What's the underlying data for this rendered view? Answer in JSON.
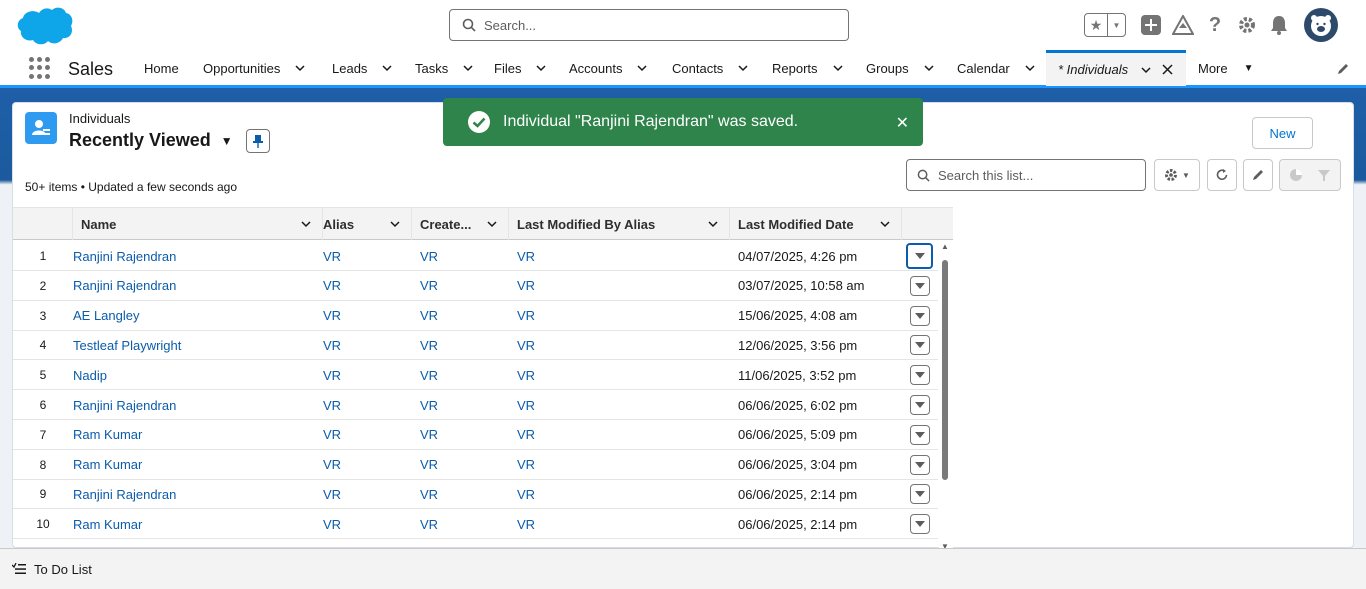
{
  "header": {
    "search_placeholder": "Search..."
  },
  "nav": {
    "app_name": "Sales",
    "tabs": [
      "Home",
      "Opportunities",
      "Leads",
      "Tasks",
      "Files",
      "Accounts",
      "Contacts",
      "Reports",
      "Groups",
      "Calendar"
    ],
    "active_tab": "* Individuals",
    "more": "More"
  },
  "list": {
    "object_label": "Individuals",
    "view_name": "Recently Viewed",
    "meta": "50+ items • Updated a few seconds ago",
    "new_button": "New",
    "search_placeholder": "Search this list..."
  },
  "toast": {
    "message": "Individual \"Ranjini Rajendran\" was saved."
  },
  "table": {
    "columns": [
      "Name",
      "Alias",
      "Create...",
      "Last Modified By Alias",
      "Last Modified Date"
    ],
    "rows": [
      {
        "n": "1",
        "name": "Ranjini Rajendran",
        "alias": "VR",
        "created": "VR",
        "lm_alias": "VR",
        "lm_date": "04/07/2025, 4:26 pm"
      },
      {
        "n": "2",
        "name": "Ranjini Rajendran",
        "alias": "VR",
        "created": "VR",
        "lm_alias": "VR",
        "lm_date": "03/07/2025, 10:58 am"
      },
      {
        "n": "3",
        "name": "AE Langley",
        "alias": "VR",
        "created": "VR",
        "lm_alias": "VR",
        "lm_date": "15/06/2025, 4:08 am"
      },
      {
        "n": "4",
        "name": "Testleaf Playwright",
        "alias": "VR",
        "created": "VR",
        "lm_alias": "VR",
        "lm_date": "12/06/2025, 3:56 pm"
      },
      {
        "n": "5",
        "name": "Nadip",
        "alias": "VR",
        "created": "VR",
        "lm_alias": "VR",
        "lm_date": "11/06/2025, 3:52 pm"
      },
      {
        "n": "6",
        "name": "Ranjini Rajendran",
        "alias": "VR",
        "created": "VR",
        "lm_alias": "VR",
        "lm_date": "06/06/2025, 6:02 pm"
      },
      {
        "n": "7",
        "name": "Ram Kumar",
        "alias": "VR",
        "created": "VR",
        "lm_alias": "VR",
        "lm_date": "06/06/2025, 5:09 pm"
      },
      {
        "n": "8",
        "name": "Ram Kumar",
        "alias": "VR",
        "created": "VR",
        "lm_alias": "VR",
        "lm_date": "06/06/2025, 3:04 pm"
      },
      {
        "n": "9",
        "name": "Ranjini Rajendran",
        "alias": "VR",
        "created": "VR",
        "lm_alias": "VR",
        "lm_date": "06/06/2025, 2:14 pm"
      },
      {
        "n": "10",
        "name": "Ram Kumar",
        "alias": "VR",
        "created": "VR",
        "lm_alias": "VR",
        "lm_date": "06/06/2025, 2:14 pm"
      }
    ]
  },
  "footer": {
    "todo_label": "To Do List"
  },
  "colors": {
    "brand": "#0176d3",
    "link": "#0b5cab",
    "toast_success": "#2e844a",
    "object_icon": "#2e9bf0"
  }
}
